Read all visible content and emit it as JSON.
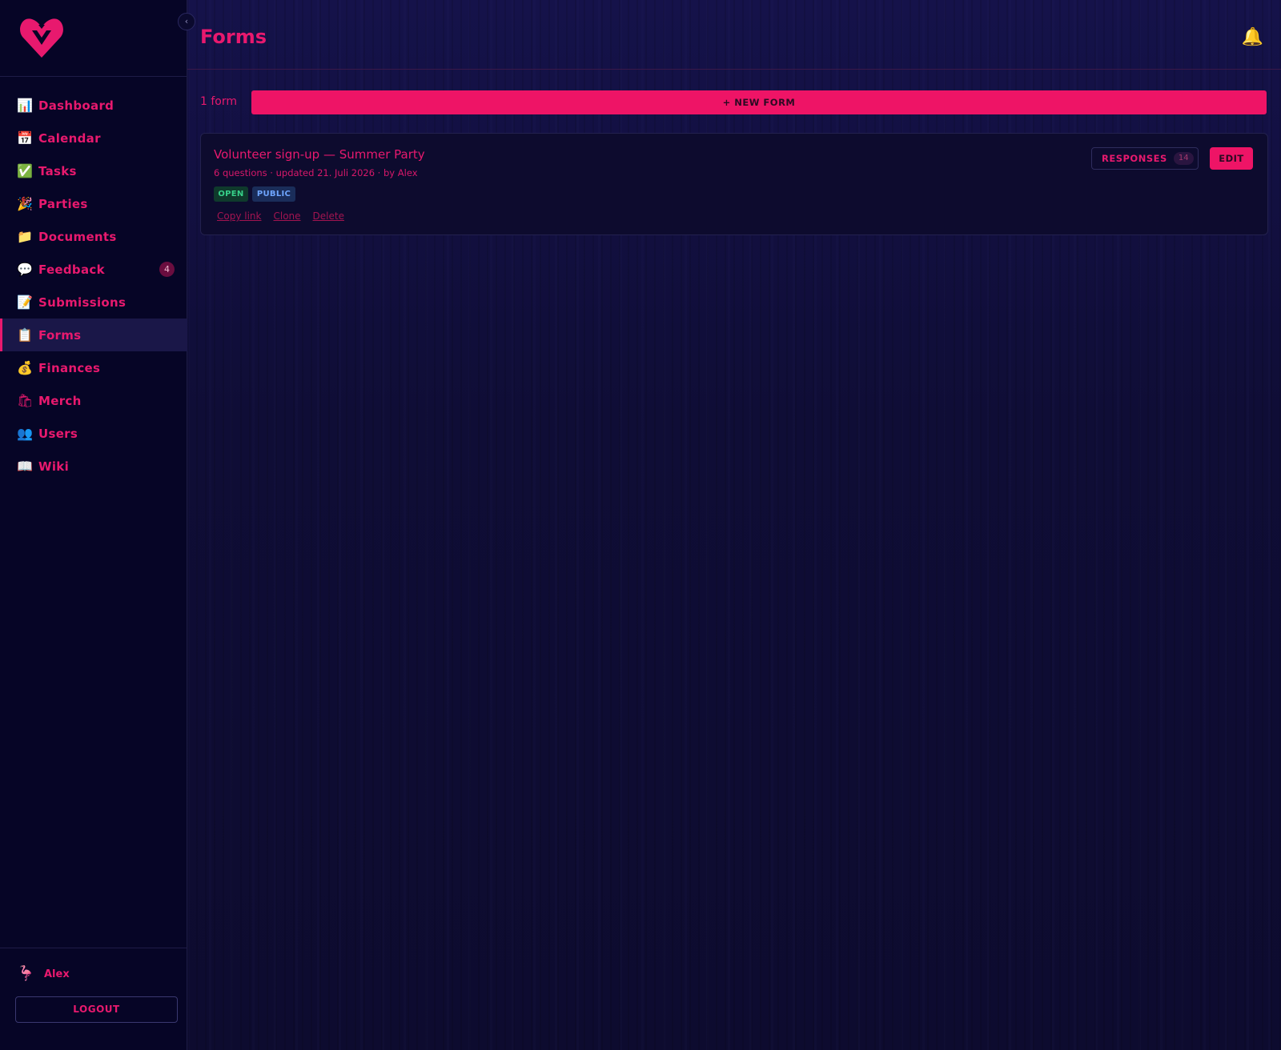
{
  "sidebar": {
    "logo_icon": "heart-logo-icon",
    "collapse_symbol": "‹",
    "items": [
      {
        "label": "Dashboard",
        "icon": "📊"
      },
      {
        "label": "Calendar",
        "icon": "📅"
      },
      {
        "label": "Tasks",
        "icon": "✅"
      },
      {
        "label": "Parties",
        "icon": "🎉"
      },
      {
        "label": "Documents",
        "icon": "📁"
      },
      {
        "label": "Feedback",
        "icon": "💬",
        "badge": "4"
      },
      {
        "label": "Submissions",
        "icon": "📝"
      },
      {
        "label": "Forms",
        "icon": "📋",
        "active": true
      },
      {
        "label": "Finances",
        "icon": "💰"
      },
      {
        "label": "Merch",
        "icon": "🛍"
      },
      {
        "label": "Users",
        "icon": "👥"
      },
      {
        "label": "Wiki",
        "icon": "📖"
      }
    ],
    "user": {
      "avatar": "🦩",
      "name": "Alex"
    },
    "logout_label": "LOGOUT"
  },
  "header": {
    "title": "Forms",
    "bell": "🔔"
  },
  "toolbar": {
    "count_label": "1 form",
    "new_form_label": "+ NEW FORM"
  },
  "forms": [
    {
      "title": "Volunteer sign-up — Summer Party",
      "meta": "6 questions · updated 21. Juli 2026 · by Alex",
      "tags": {
        "open": "OPEN",
        "public": "PUBLIC"
      },
      "actions": {
        "copy": "Copy link",
        "clone": "Clone",
        "delete": "Delete"
      },
      "responses_label": "RESPONSES",
      "responses_count": "14",
      "edit_label": "EDIT"
    }
  ],
  "colors": {
    "accent": "#ee1466",
    "sidebar_bg": "#060526",
    "main_bg": "#0f0d36",
    "open_tag": "#37d18a",
    "public_tag": "#6fa6ff"
  }
}
